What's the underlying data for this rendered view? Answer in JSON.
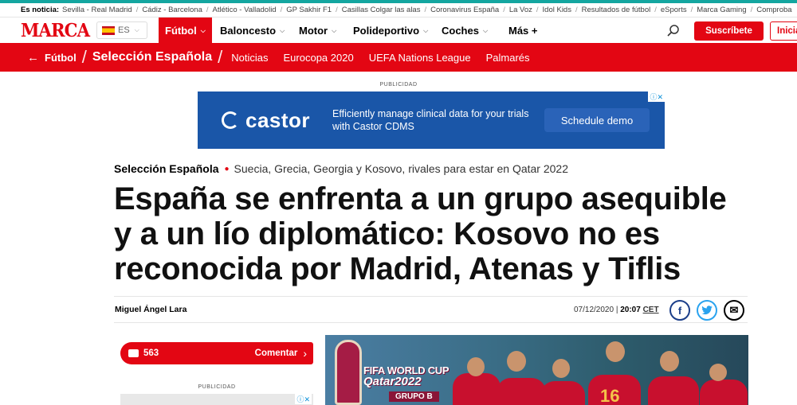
{
  "ticker": {
    "label": "Es noticia:",
    "items": [
      "Sevilla - Real Madrid",
      "Cádiz - Barcelona",
      "Atlético - Valladolid",
      "GP Sakhir F1",
      "Casillas Colgar las alas",
      "Coronavirus España",
      "La Voz",
      "Idol Kids",
      "Resultados de fútbol",
      "eSports",
      "Marca Gaming",
      "Comproba"
    ]
  },
  "header": {
    "logo": "MARCA",
    "lang": "ES",
    "nav": [
      "Fútbol",
      "Baloncesto",
      "Motor",
      "Polideportivo",
      "Coches",
      "Más +"
    ],
    "subscribe": "Suscríbete",
    "login": "Inicia"
  },
  "subnav": {
    "back": "Fútbol",
    "section": "Selección Española",
    "links": [
      "Noticias",
      "Eurocopa 2020",
      "UEFA Nations League",
      "Palmarés"
    ]
  },
  "ad": {
    "label": "PUBLICIDAD",
    "brand": "castor",
    "text": "Efficiently manage clinical data for your trials with Castor CDMS",
    "cta": "Schedule demo",
    "close": "ⓘ✕"
  },
  "article": {
    "kicker_section": "Selección Española",
    "kicker_sub": "Suecia, Grecia, Georgia y Kosovo, rivales para estar en Qatar 2022",
    "headline": "España se enfrenta a un grupo asequible y a un lío diplomático: Kosovo no es reconocida por Madrid, Atenas y Tiflis",
    "author": "Miguel Ángel Lara",
    "date": "07/12/2020",
    "time": "20:07",
    "tz": "CET"
  },
  "share": {
    "facebook": "f",
    "twitter": "t",
    "email": "✉"
  },
  "comments": {
    "count": "563",
    "cta": "Comentar"
  },
  "sidebar_ad": {
    "label": "PUBLICIDAD"
  },
  "photo": {
    "title": "FIFA WORLD CUP",
    "subtitle": "Qatar2022",
    "group": "GRUPO B",
    "shirt_number": "16"
  },
  "colors": {
    "brand_red": "#e30613",
    "ad_blue": "#1a56a8",
    "accent_teal": "#14a6a0"
  }
}
